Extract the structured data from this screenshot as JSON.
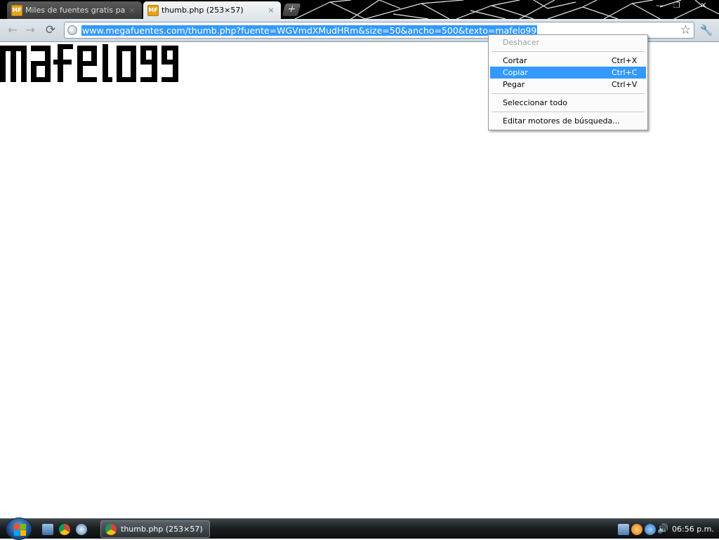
{
  "tabs": [
    {
      "favicon": "MF",
      "title": "Miles de fuentes gratis par...",
      "close": "×",
      "active": false
    },
    {
      "favicon": "MF",
      "title": "thumb.php (253×57)",
      "close": "×",
      "active": true
    }
  ],
  "tabstrip": {
    "new_tab": "+"
  },
  "window_controls": {
    "minimize": "—",
    "maximize": "❐",
    "close": "✕"
  },
  "toolbar": {
    "back_icon": "←",
    "forward_icon": "→",
    "reload_icon": "⟳",
    "url": "www.megafuentes.com/thumb.php?fuente=WGVmdXMudHRm&size=50&ancho=500&texto=mafelo99",
    "star_icon": "☆",
    "wrench_icon": "🔧"
  },
  "page": {
    "preview_text": "mafelo99"
  },
  "context_menu": {
    "items": [
      {
        "label": "Deshacer",
        "shortcut": "",
        "state": "disabled"
      },
      {
        "label": "Cortar",
        "shortcut": "Ctrl+X",
        "state": "normal"
      },
      {
        "label": "Copiar",
        "shortcut": "Ctrl+C",
        "state": "highlighted"
      },
      {
        "label": "Pegar",
        "shortcut": "Ctrl+V",
        "state": "normal"
      },
      {
        "label": "Seleccionar todo",
        "shortcut": "",
        "state": "normal"
      },
      {
        "label": "Editar motores de búsqueda...",
        "shortcut": "",
        "state": "normal"
      }
    ]
  },
  "taskbar": {
    "task_label": "thumb.php (253×57) -...",
    "volume_icon": "🔊",
    "clock": "06:56 p.m."
  },
  "colors": {
    "selection": "#3399ff",
    "titlebar": "#000000",
    "toolbar": "#dfe6ec",
    "favicon": "#e4a21a"
  },
  "icons": {
    "start": "windows-orb-icon",
    "quick_launch": [
      "show-desktop-icon",
      "chrome-icon",
      "media-player-icon"
    ],
    "tray": [
      "network-icon",
      "app-tray-icon",
      "app-tray-icon",
      "volume-icon"
    ]
  }
}
